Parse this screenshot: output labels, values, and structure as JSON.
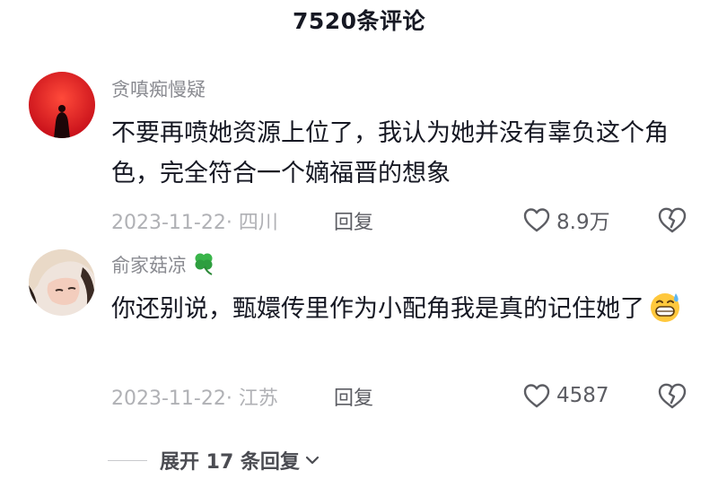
{
  "header": {
    "title": "7520条评论"
  },
  "comments": [
    {
      "username": "贪嗔痴慢疑",
      "text": "不要再喷她资源上位了，我认为她并没有辜负这个角色，完全符合一个嫡福晋的想象",
      "date_location": "2023-11-22· 四川",
      "reply_label": "回复",
      "likes": "8.9万"
    },
    {
      "username": "俞家菇凉",
      "username_icon": "four-leaf-clover-icon",
      "text": "你还别说，甄嬛传里作为小配角我是真的记住她了",
      "emoji": "grinning-sweat-emoji",
      "date_location": "2023-11-22· 江苏",
      "reply_label": "回复",
      "likes": "4587"
    }
  ],
  "expand": {
    "label": "展开 17 条回复"
  },
  "colors": {
    "text": "#161823",
    "secondary": "#8a8b91",
    "muted": "#b0b1b5"
  }
}
